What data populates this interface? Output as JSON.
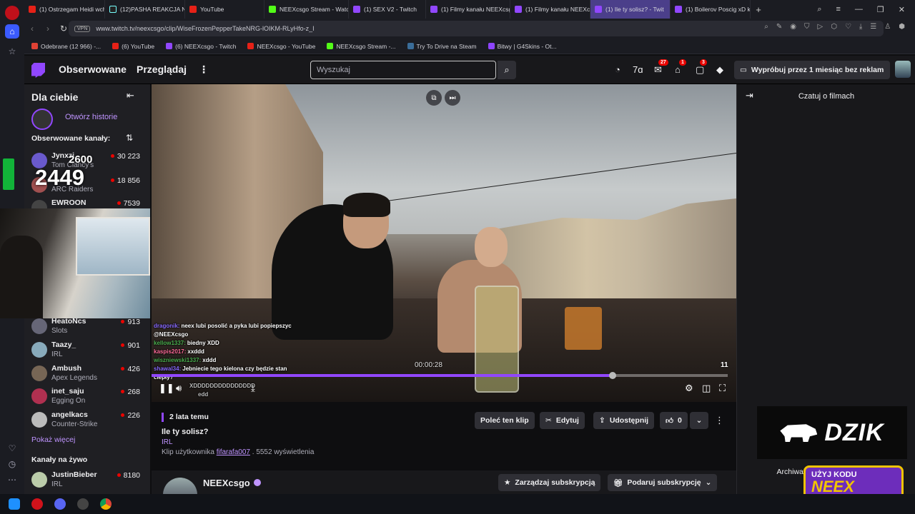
{
  "browser": {
    "tabs": [
      {
        "label": "(1) Ostrzegam Heidi wcho",
        "icon": "youtube-icon",
        "active": false
      },
      {
        "label": "(12)PASHA REAKCJA NA K",
        "icon": "tiktok-icon",
        "active": false
      },
      {
        "label": "YouTube",
        "icon": "youtube-icon",
        "active": false
      },
      {
        "label": "NEEXcsgo Stream - Watch",
        "icon": "kick-icon",
        "active": false
      },
      {
        "label": "(1) SEX V2 - Twitch",
        "icon": "twitch-icon",
        "active": false
      },
      {
        "label": "(1) Filmy kanału NEEXcsg",
        "icon": "twitch-icon",
        "active": false
      },
      {
        "label": "(1) Filmy kanału NEEXcsg",
        "icon": "twitch-icon",
        "active": false
      },
      {
        "label": "(1) Ile ty solisz? - Twit",
        "icon": "twitch-icon",
        "active": true
      },
      {
        "label": "(1) Boilerov Poscig xD kar",
        "icon": "twitch-icon",
        "active": false
      }
    ],
    "new_tab": "+",
    "url": "www.twitch.tv/neexcsgo/clip/WiseFrozenPepperTakeNRG-lOIKM-RLyHfo-z_I",
    "vpn_label": "VPN",
    "bookmarks": [
      {
        "label": "Odebrane (12 966) -...",
        "icon": "gmail-icon"
      },
      {
        "label": "(6) YouTube",
        "icon": "youtube-icon"
      },
      {
        "label": "(6) NEEXcsgo - Twitch",
        "icon": "twitch-icon"
      },
      {
        "label": "NEEXcsgo - YouTube",
        "icon": "youtube-icon"
      },
      {
        "label": "NEEXcsgo Stream -...",
        "icon": "kick-icon"
      },
      {
        "label": "Try To Drive na Steam",
        "icon": "steam-icon"
      },
      {
        "label": "Bitwy | G4Skins - Ot...",
        "icon": "g4skins-icon"
      }
    ]
  },
  "twitch": {
    "nav": {
      "following": "Obserwowane",
      "browse": "Przeglądaj",
      "search_placeholder": "Wyszukaj",
      "badges": {
        "inbox": "27",
        "notifications": "1",
        "whispers": "3"
      },
      "try_button": "Wypróbuj przez 1 miesiąc bez reklam"
    },
    "sidebar": {
      "for_you": "Dla ciebie",
      "stories_label": "Otwórz historie",
      "followed_header": "Obserwowane kanały:",
      "channels": [
        {
          "name": "Jynxzi",
          "game": "Tom Clancy's",
          "viewers": "30 223",
          "color": "#6a5acd"
        },
        {
          "name": "",
          "game": "ARC Raiders",
          "viewers": "18 856",
          "color": "#a05050"
        },
        {
          "name": "EWROON",
          "game": "",
          "viewers": "7539",
          "color": "#444"
        },
        {
          "name": "HeatoNcs",
          "game": "Slots",
          "viewers": "913",
          "color": "#667"
        },
        {
          "name": "Taazy_",
          "game": "IRL",
          "viewers": "901",
          "color": "#8ab"
        },
        {
          "name": "Ambush",
          "game": "Apex Legends",
          "viewers": "426",
          "color": "#765"
        },
        {
          "name": "inet_saju",
          "game": "Egging On",
          "viewers": "268",
          "color": "#b03050"
        },
        {
          "name": "angelkacs",
          "game": "Counter-Strike",
          "viewers": "226",
          "color": "#bbb"
        }
      ],
      "show_more": "Pokaż więcej",
      "live_header": "Kanały na żywo",
      "live_channels": [
        {
          "name": "JustinBieber",
          "game": "IRL",
          "viewers": "8180",
          "color": "#bca"
        }
      ]
    },
    "overlay_counter": {
      "small": "2600",
      "big": "2449"
    },
    "player": {
      "chat_lines": [
        {
          "user": "dragonik:",
          "text": "neex lubi posolić a pyka lubi popiepszyc @NEEXcsgo",
          "color": "#8a6bff"
        },
        {
          "user": "kellow1337:",
          "text": "biedny XDD",
          "color": "#4caf50"
        },
        {
          "user": "kaspis2017:",
          "text": "xxddd",
          "color": "#ff6b9a"
        },
        {
          "user": "wiszniewski1337:",
          "text": "xddd",
          "color": "#4caf50"
        },
        {
          "user": "shawal34:",
          "text": "Jebniecie tego kielona czy będzie stan ciepły?",
          "color": "#8a6bff"
        },
        {
          "user": "",
          "text": "XDDDDDDDDDDDDDDD",
          "color": "#bbb"
        },
        {
          "user": "",
          "text": "edd",
          "color": "#bbb"
        }
      ],
      "time": "00:00:28",
      "count": "11",
      "progress": 0.8
    },
    "clip": {
      "age": "2 lata temu",
      "title": "Ile ty solisz?",
      "category": "IRL",
      "by_prefix": "Klip użytkownika",
      "author": "fifarafa007",
      "views": "5552 wyświetlenia",
      "recommend": "Poleć ten klip",
      "edit": "Edytuj",
      "share": "Udostępnij",
      "likes": "0"
    },
    "channel": {
      "name": "NEEXcsgo",
      "manage_sub": "Zarządzaj subskrypcją",
      "gift_sub": "Podaruj subskrypcję"
    },
    "chat_panel": {
      "title": "Czatuj o filmach",
      "archive": "Archiwalna transmisja czatem"
    },
    "sponsor": {
      "brand": "DZIK",
      "promo_line1": "UŻYJ KODU",
      "promo_line2": "NEEX"
    }
  }
}
